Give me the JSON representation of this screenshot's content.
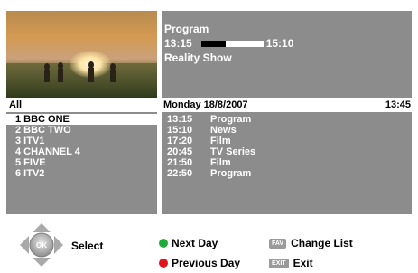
{
  "program_info": {
    "title": "Program",
    "start_time": "13:15",
    "end_time": "15:10",
    "progress": 0.4,
    "description": "Reality Show"
  },
  "channel_list": {
    "heading": "All",
    "items": [
      {
        "label": "1 BBC ONE",
        "selected": true
      },
      {
        "label": "2 BBC TWO",
        "selected": false
      },
      {
        "label": "3 ITV1",
        "selected": false
      },
      {
        "label": "4 CHANNEL 4",
        "selected": false
      },
      {
        "label": "5 FIVE",
        "selected": false
      },
      {
        "label": "6 ITV2",
        "selected": false
      }
    ]
  },
  "schedule": {
    "date": "Monday 18/8/2007",
    "clock": "13:45",
    "rows": [
      {
        "time": "13:15",
        "title": "Program"
      },
      {
        "time": "15:10",
        "title": "News"
      },
      {
        "time": "17:20",
        "title": "Film"
      },
      {
        "time": "20:45",
        "title": "TV Series"
      },
      {
        "time": "21:50",
        "title": "Film"
      },
      {
        "time": "22:50",
        "title": "Program"
      }
    ]
  },
  "footer": {
    "select_label": "Select",
    "ok_label": "OK",
    "next_day_label": "Next Day",
    "previous_day_label": "Previous Day",
    "fav_key": "FAV",
    "change_list_label": "Change List",
    "exit_key": "EXIT",
    "exit_label": "Exit"
  },
  "colors": {
    "panel": "#8c8c8c",
    "green_button": "#1faa3c",
    "red_button": "#e0141a"
  },
  "icons": [
    "navigation-pad-icon",
    "green-dot-icon",
    "red-dot-icon",
    "fav-key-icon",
    "exit-key-icon"
  ]
}
